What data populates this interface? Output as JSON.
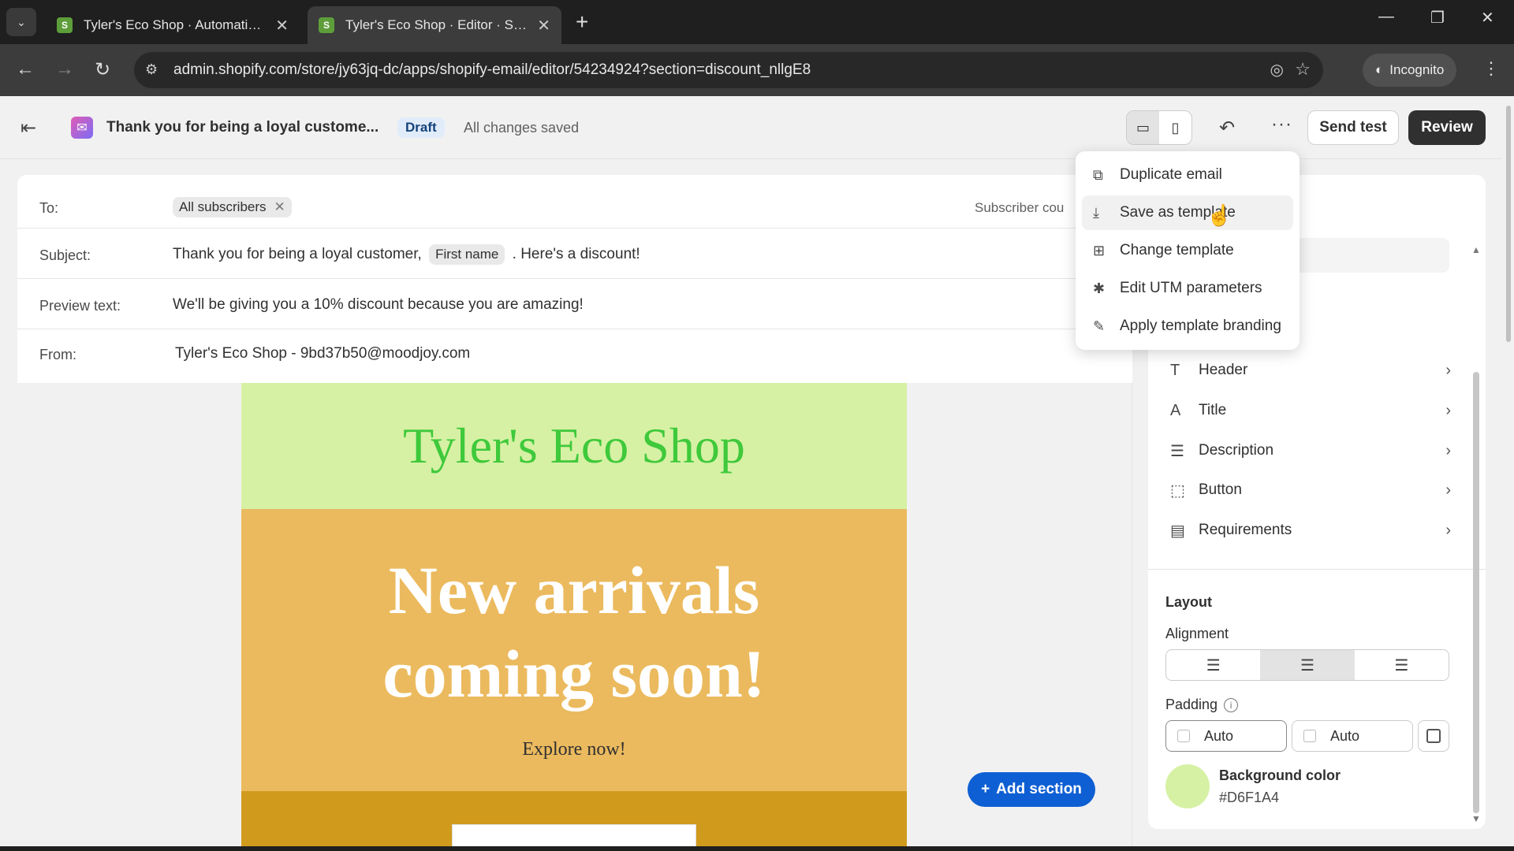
{
  "browser": {
    "tabs": [
      {
        "title": "Tyler's Eco Shop · Automations",
        "active": false
      },
      {
        "title": "Tyler's Eco Shop · Editor · Shopify",
        "active": true
      }
    ],
    "url": "admin.shopify.com/store/jy63jq-dc/apps/shopify-email/editor/54234924?section=discount_nllgE8",
    "incognito_label": "Incognito"
  },
  "header": {
    "email_name": "Thank you for being a loyal custome...",
    "status_badge": "Draft",
    "save_status": "All changes saved",
    "send_test_label": "Send test",
    "review_label": "Review"
  },
  "fields": {
    "to_label": "To:",
    "to_chip": "All subscribers",
    "subscriber_count": "Subscriber cou",
    "subject_label": "Subject:",
    "subject_before": "Thank you for being a loyal customer,",
    "subject_token": "First name",
    "subject_after": ". Here's a discount!",
    "preview_label": "Preview text:",
    "preview_value": "We'll be giving you a 10% discount because you are amazing!",
    "from_label": "From:",
    "from_value": "Tyler's Eco Shop - 9bd37b50@moodjoy.com"
  },
  "email_preview": {
    "shop_name": "Tyler's Eco Shop",
    "hero_line1": "New arrivals",
    "hero_line2": "coming soon!",
    "hero_sub": "Explore now!",
    "header_bg": "#D6F1A4",
    "hero_bg": "#EBBA5E"
  },
  "add_section_label": "Add section",
  "menu": {
    "items": [
      {
        "label": "Duplicate email",
        "icon": "duplicate-icon"
      },
      {
        "label": "Save as template",
        "icon": "save-template-icon"
      },
      {
        "label": "Change template",
        "icon": "change-template-icon"
      },
      {
        "label": "Edit UTM parameters",
        "icon": "utm-icon"
      },
      {
        "label": "Apply template branding",
        "icon": "branding-icon"
      }
    ]
  },
  "panel": {
    "sections": [
      {
        "label": "Header",
        "icon": "text-icon"
      },
      {
        "label": "Title",
        "icon": "title-icon"
      },
      {
        "label": "Description",
        "icon": "description-icon"
      },
      {
        "label": "Button",
        "icon": "button-icon"
      },
      {
        "label": "Requirements",
        "icon": "requirements-icon"
      }
    ],
    "layout_title": "Layout",
    "alignment_label": "Alignment",
    "alignment_selected": "center",
    "padding_label": "Padding",
    "padding_vertical": "Auto",
    "padding_horizontal": "Auto",
    "bg_color_label": "Background color",
    "bg_color_value": "#D6F1A4"
  }
}
